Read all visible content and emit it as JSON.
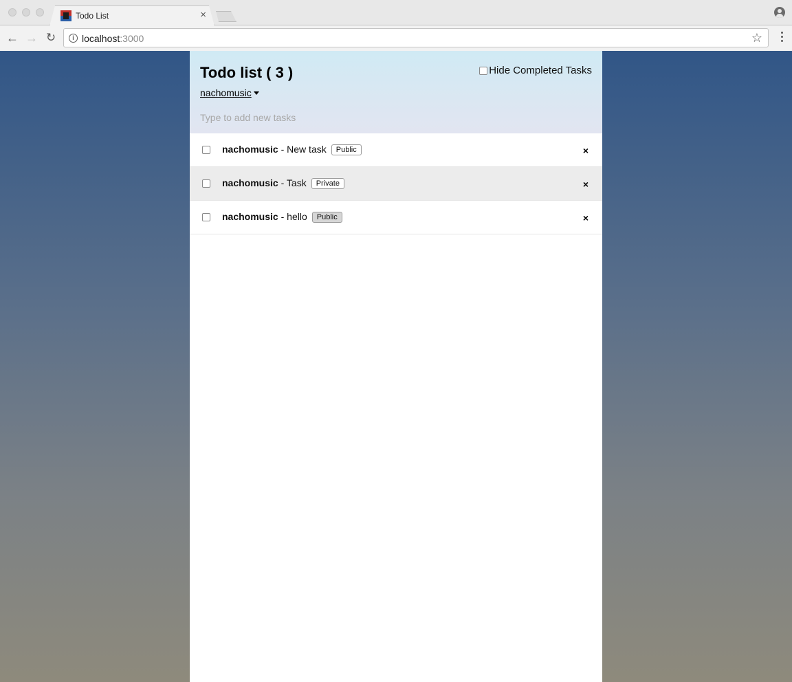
{
  "browser": {
    "tab_title": "Todo List",
    "url_host": "localhost",
    "url_port": ":3000"
  },
  "app": {
    "title": "Todo list ( 3 )",
    "hide_completed_label": "Hide Completed Tasks",
    "user_menu_label": "nachomusic",
    "new_task_placeholder": "Type to add new tasks"
  },
  "tasks": [
    {
      "owner": "nachomusic",
      "separator": " - ",
      "text": "New task",
      "visibility": "Public",
      "checked": false
    },
    {
      "owner": "nachomusic",
      "separator": " - ",
      "text": "Task",
      "visibility": "Private",
      "checked": false
    },
    {
      "owner": "nachomusic",
      "separator": " - ",
      "text": "hello",
      "visibility": "Public",
      "checked": false
    }
  ],
  "icons": {
    "delete": "close-icon"
  },
  "colors": {
    "header_top": "#d0eaf4",
    "header_bottom": "#e2e5f1",
    "page_bg_top": "#315687",
    "page_bg_bottom": "#8e8a7c",
    "private_row": "#ececec"
  }
}
